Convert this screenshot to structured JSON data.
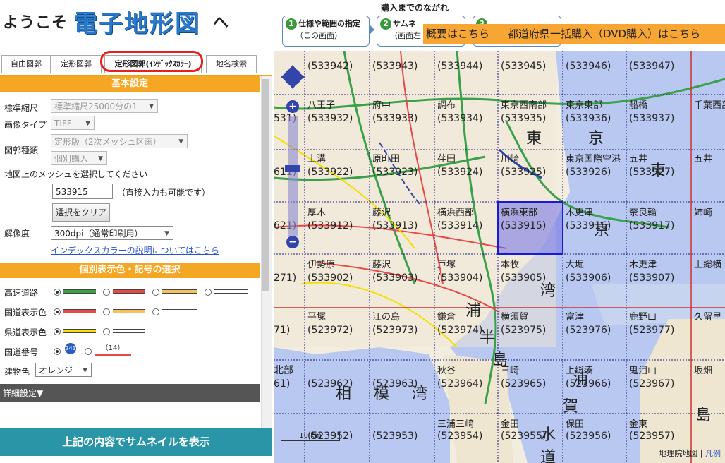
{
  "header": {
    "welcome": "ようこそ",
    "brand": "電子地形図",
    "welcome_suffix": "へ",
    "flow_title": "購入までのながれ",
    "steps": [
      {
        "num": "1",
        "line1": "仕様や範囲の指定",
        "line2": "（この画面）"
      },
      {
        "num": "2",
        "line1": "サムネ",
        "line2": "（画面左"
      },
      {
        "num": "3",
        "line1": "",
        "line2": ""
      }
    ],
    "overview_button": "概要はこちら",
    "dvd_button": "都道府県一括購入（DVD購入）はこちら"
  },
  "tabs": [
    {
      "label": "自由図郭"
    },
    {
      "label": "定形図郭"
    },
    {
      "label": "定形図郭(ｲﾝﾃﾞｯｸｽｶﾗｰ)"
    },
    {
      "label": "地名検索"
    }
  ],
  "basic": {
    "title": "基本設定",
    "scale_label": "標準縮尺",
    "scale_value": "標準縮尺25000分の1",
    "image_type_label": "画像タイプ",
    "image_type_value": "TIFF",
    "map_type_label": "図郭種類",
    "map_type_value": "定形版（2次メッシュ区画）",
    "purchase_value": "個別購入",
    "mesh_prompt": "地図上のメッシュを選択してください",
    "mesh_input_value": "533915",
    "mesh_input_hint": "（直接入力も可能です）",
    "clear_button": "選択をクリア",
    "resolution_label": "解像度",
    "resolution_value": "300dpi（通常印刷用）",
    "index_color_link": "インデックスカラーの説明についてはこちら"
  },
  "display": {
    "title": "個別表示色・記号の選択",
    "rows": [
      {
        "label": "高速道路"
      },
      {
        "label": "国道表示色"
      },
      {
        "label": "県道表示色"
      },
      {
        "label": "国道番号"
      }
    ],
    "route_badge": "241",
    "route_text": "（14）",
    "building_label": "建物色",
    "building_value": "オレンジ",
    "colors": {
      "green": "#3aa04a",
      "red": "#e84848",
      "yellow": "#f4e000",
      "orange": "#f7c060"
    }
  },
  "advanced_label": "詳細設定▼",
  "thumbnail_button": "上記の内容でサムネイルを表示",
  "map": {
    "scale_text": "10 km",
    "credit": "地理院地図",
    "credit_link": "凡例",
    "meshes": [
      [
        "533942",
        "533943",
        "533944",
        "533945",
        "533946",
        "533947"
      ],
      [
        "533932",
        "533933",
        "533934",
        "533935",
        "533936",
        "533937"
      ],
      [
        "533922",
        "533923",
        "533924",
        "533925",
        "533926",
        "533927"
      ],
      [
        "533912",
        "533913",
        "533914",
        "533915",
        "533916",
        "533917"
      ],
      [
        "533902",
        "533903",
        "533904",
        "533905",
        "533906",
        "533907"
      ],
      [
        "523972",
        "523973",
        "523974",
        "523975",
        "523976",
        "523977"
      ],
      [
        "523962",
        "523963",
        "523964",
        "523965",
        "523966",
        "523967"
      ],
      [
        "523952",
        "523953",
        "523954",
        "523955",
        "523956",
        "523957"
      ]
    ],
    "places": [
      [
        "八王子",
        "府中",
        "調布",
        "東京西南部",
        "東京東部",
        "船橋"
      ],
      [
        "上溝",
        "原町田",
        "荏田",
        "川崎",
        "東京国際空港",
        "五井"
      ],
      [
        "厚木",
        "藤沢",
        "横浜西部",
        "横浜東部",
        "木更津",
        "奈良輪"
      ],
      [
        "伊勢原",
        "藤沢",
        "戸塚",
        "本牧",
        "大堀",
        "木更津"
      ],
      [
        "平塚",
        "江の島",
        "鎌倉",
        "横須賀",
        "富津",
        "鹿野山"
      ],
      [
        "",
        "",
        "秋谷",
        "三崎",
        "上総湊",
        "鬼泪山"
      ],
      [
        "",
        "",
        "三浦三崎",
        "金田",
        "保田",
        "金束"
      ]
    ],
    "right_col": [
      "千葉西部",
      "五井",
      "姉崎",
      "上総横",
      "久留里",
      "坂畑"
    ],
    "left_edge": [
      "531)",
      "611)",
      "621)",
      "271)",
      "71)",
      "北部",
      "61)"
    ],
    "big_kanji": [
      "東",
      "京",
      "東",
      "京",
      "湾",
      "浦",
      "半",
      "島",
      "相",
      "模",
      "湾",
      "浦",
      "賀",
      "水",
      "道",
      "島"
    ]
  }
}
